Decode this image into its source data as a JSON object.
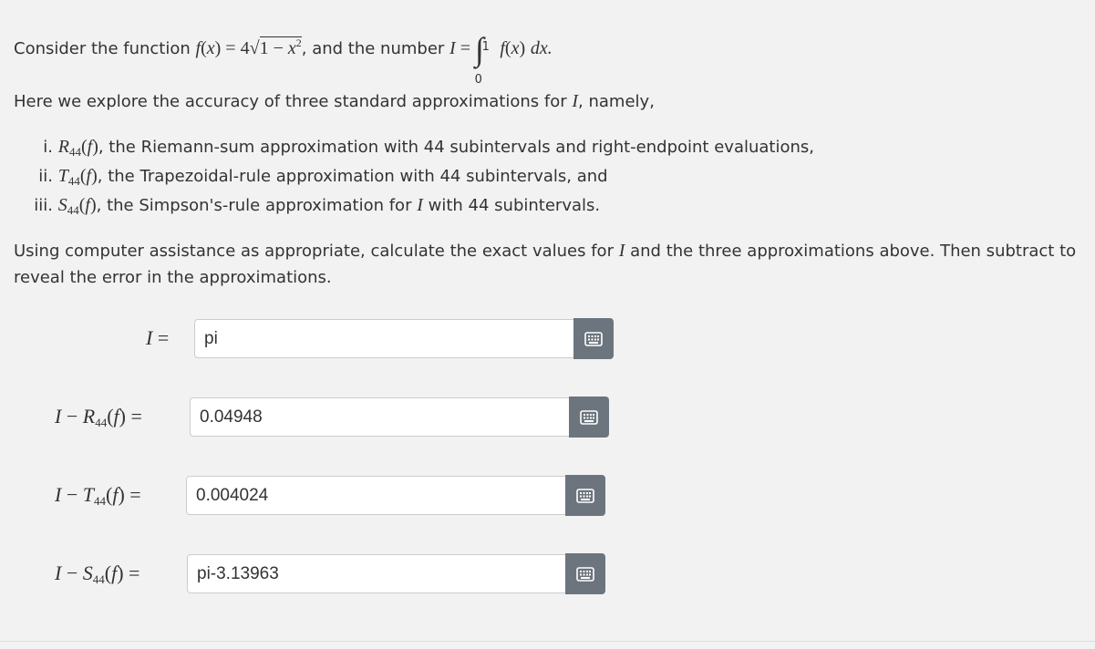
{
  "intro": {
    "consider": "Consider the function",
    "and_number": ", and the number",
    "f_name": "f",
    "x_var": "x",
    "coef": "4",
    "one": "1",
    "exp": "2",
    "I": "I",
    "upper_limit": "1",
    "lower_limit": "0",
    "dx": "dx."
  },
  "explore": {
    "text_before": "Here we explore the accuracy of three standard approximations for",
    "text_after": ", namely,"
  },
  "list": [
    {
      "num": "i.",
      "sym": "R",
      "sub": "44",
      "text": ", the Riemann-sum approximation with 44 subintervals and right-endpoint evaluations,"
    },
    {
      "num": "ii.",
      "sym": "T",
      "sub": "44",
      "text": ", the Trapezoidal-rule approximation with 44 subintervals, and"
    },
    {
      "num": "iii.",
      "sym": "S",
      "sub": "44",
      "text": ", the Simpson's-rule approximation for",
      "text2": "with 44 subintervals."
    }
  ],
  "instructions": {
    "line1_before": "Using computer assistance as appropriate, calculate the exact values for",
    "line1_after": "and the three approximations above. Then subtract to",
    "line2": "reveal the error in the approximations."
  },
  "answers": [
    {
      "label_sym": "",
      "label_sub": "",
      "value": "pi"
    },
    {
      "label_sym": "R",
      "label_sub": "44",
      "value": "0.04948"
    },
    {
      "label_sym": "T",
      "label_sub": "44",
      "value": "0.004024"
    },
    {
      "label_sym": "S",
      "label_sub": "44",
      "value": "pi-3.13963"
    }
  ],
  "icons": {
    "keyboard": "keyboard-icon"
  },
  "colors": {
    "button": "#6c757d",
    "background": "#f2f2f2"
  }
}
